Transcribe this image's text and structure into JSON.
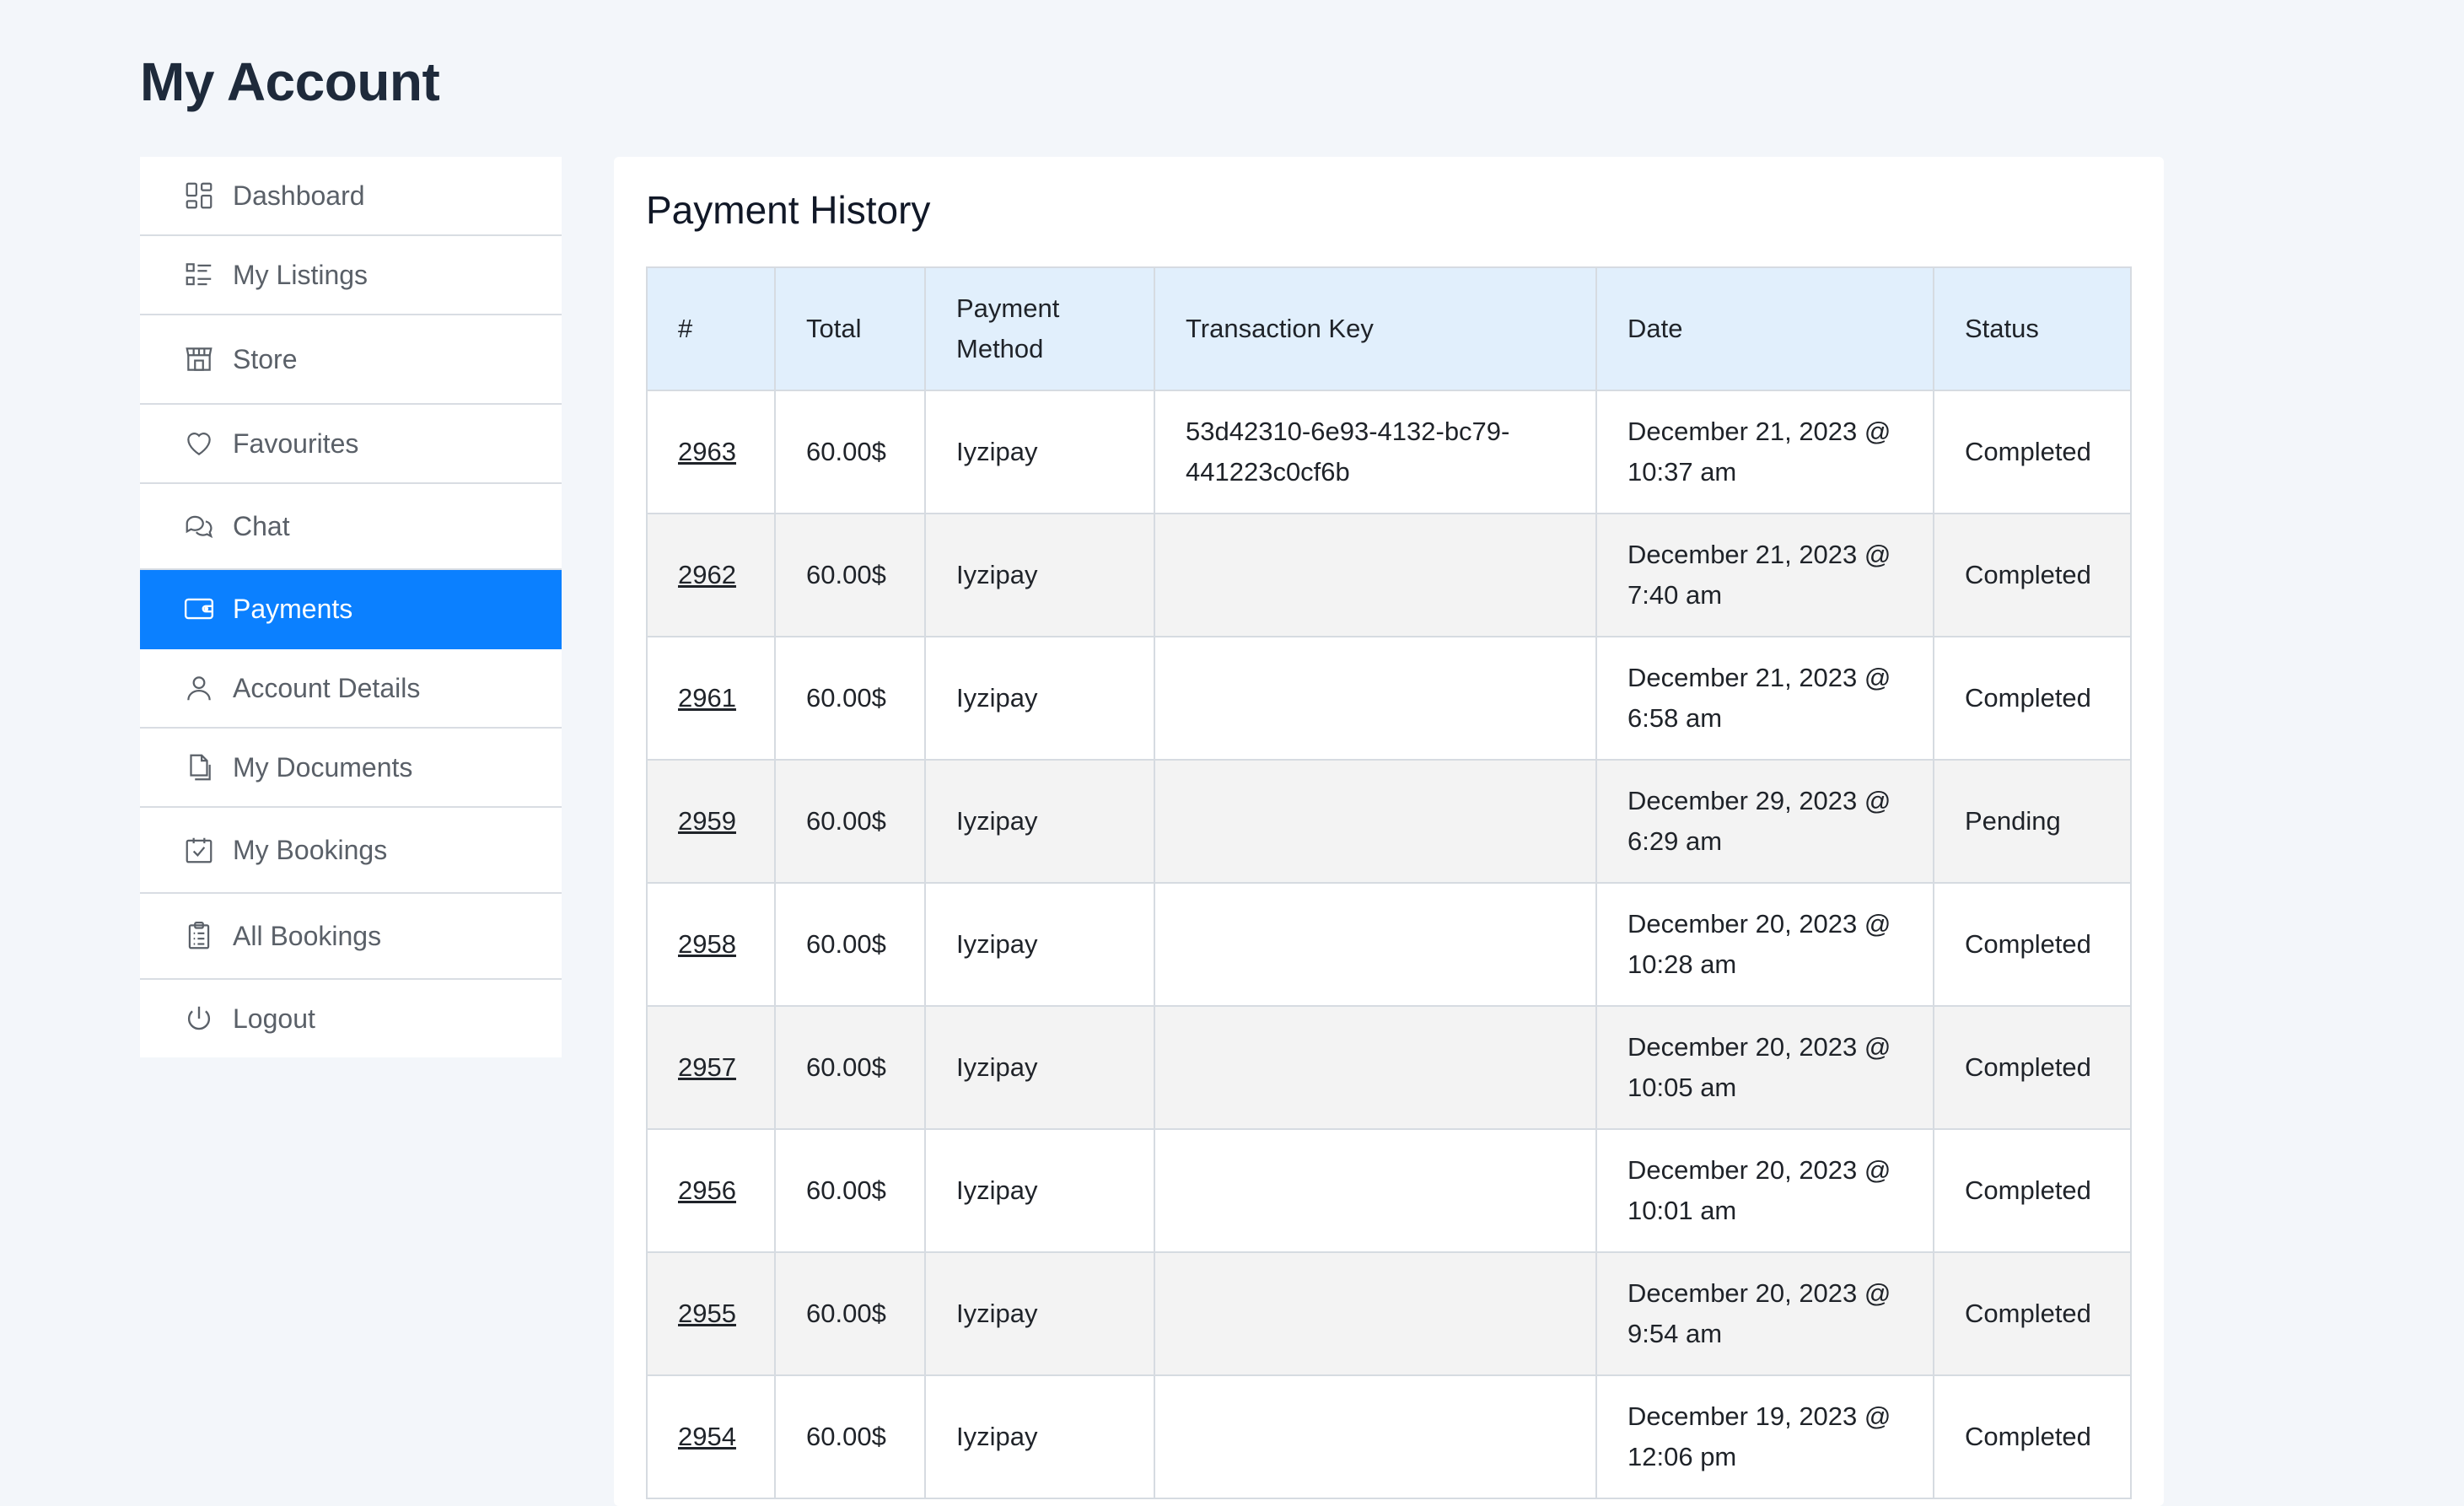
{
  "page": {
    "title": "My Account"
  },
  "sidebar": {
    "items": [
      {
        "label": "Dashboard",
        "icon": "dashboard-icon",
        "active": false
      },
      {
        "label": "My Listings",
        "icon": "listings-icon",
        "active": false
      },
      {
        "label": "Store",
        "icon": "store-icon",
        "active": false
      },
      {
        "label": "Favourites",
        "icon": "heart-icon",
        "active": false
      },
      {
        "label": "Chat",
        "icon": "chat-icon",
        "active": false
      },
      {
        "label": "Payments",
        "icon": "wallet-icon",
        "active": true
      },
      {
        "label": "Account Details",
        "icon": "user-icon",
        "active": false
      },
      {
        "label": "My Documents",
        "icon": "documents-icon",
        "active": false
      },
      {
        "label": "My Bookings",
        "icon": "calendar-check-icon",
        "active": false
      },
      {
        "label": "All Bookings",
        "icon": "clipboard-icon",
        "active": false
      },
      {
        "label": "Logout",
        "icon": "power-icon",
        "active": false
      }
    ]
  },
  "main": {
    "title": "Payment History",
    "table": {
      "headers": [
        "#",
        "Total",
        "Payment Method",
        "Transaction Key",
        "Date",
        "Status"
      ],
      "rows": [
        {
          "id": "2963",
          "total": "60.00$",
          "method": "Iyzipay",
          "key": "53d42310-6e93-4132-bc79-441223c0cf6b",
          "date": "December 21, 2023 @ 10:37 am",
          "status": "Completed"
        },
        {
          "id": "2962",
          "total": "60.00$",
          "method": "Iyzipay",
          "key": "",
          "date": "December 21, 2023 @ 7:40 am",
          "status": "Completed"
        },
        {
          "id": "2961",
          "total": "60.00$",
          "method": "Iyzipay",
          "key": "",
          "date": "December 21, 2023 @ 6:58 am",
          "status": "Completed"
        },
        {
          "id": "2959",
          "total": "60.00$",
          "method": "Iyzipay",
          "key": "",
          "date": "December 29, 2023 @ 6:29 am",
          "status": "Pending"
        },
        {
          "id": "2958",
          "total": "60.00$",
          "method": "Iyzipay",
          "key": "",
          "date": "December 20, 2023 @ 10:28 am",
          "status": "Completed"
        },
        {
          "id": "2957",
          "total": "60.00$",
          "method": "Iyzipay",
          "key": "",
          "date": "December 20, 2023 @ 10:05 am",
          "status": "Completed"
        },
        {
          "id": "2956",
          "total": "60.00$",
          "method": "Iyzipay",
          "key": "",
          "date": "December 20, 2023 @ 10:01 am",
          "status": "Completed"
        },
        {
          "id": "2955",
          "total": "60.00$",
          "method": "Iyzipay",
          "key": "",
          "date": "December 20, 2023 @ 9:54 am",
          "status": "Completed"
        },
        {
          "id": "2954",
          "total": "60.00$",
          "method": "Iyzipay",
          "key": "",
          "date": "December 19, 2023 @ 12:06 pm",
          "status": "Completed"
        }
      ]
    }
  },
  "colors": {
    "accent": "#0b80ff",
    "header_bg": "#e1effc",
    "page_bg": "#f3f6fa"
  }
}
